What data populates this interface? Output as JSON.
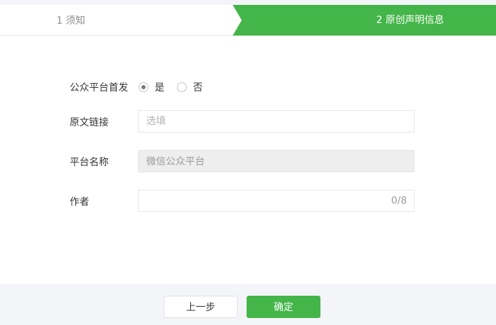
{
  "steps": [
    {
      "label": "1 须知",
      "state": "done"
    },
    {
      "label": "2 原创声明信息",
      "state": "active"
    }
  ],
  "colors": {
    "accent": "#44b549",
    "footer_bg": "#f4f5f9"
  },
  "form": {
    "first_publish": {
      "label": "公众平台首发",
      "options": [
        {
          "label": "是",
          "checked": true
        },
        {
          "label": "否",
          "checked": false
        }
      ]
    },
    "source_link": {
      "label": "原文链接",
      "value": "",
      "placeholder": "选填"
    },
    "platform_name": {
      "label": "平台名称",
      "value": "微信公众平台",
      "disabled": true
    },
    "author": {
      "label": "作者",
      "value": "",
      "counter": "0/8"
    }
  },
  "footer": {
    "prev_label": "上一步",
    "confirm_label": "确定"
  }
}
